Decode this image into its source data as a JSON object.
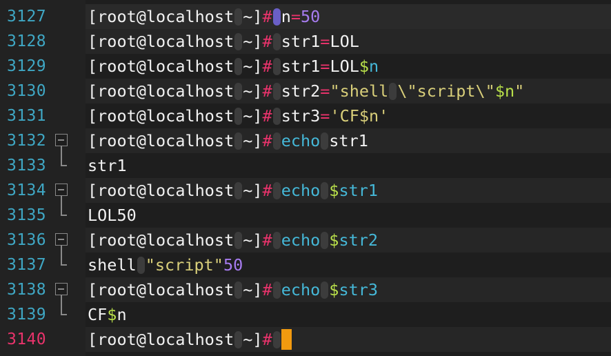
{
  "terminal": {
    "colors": {
      "background": "#1e1e1e",
      "line_number": "#3fa7c4",
      "active_line_number": "#e8336b",
      "prompt_hash": "#e8336b",
      "number": "#a77cf0",
      "string": "#d9cf7a",
      "variable": "#b9e04a",
      "command": "#45b8d8",
      "cursor": "#f29a0f"
    },
    "prompt": {
      "open": "[root@localhost",
      "dir": "~]",
      "hash": "#"
    },
    "lines": [
      {
        "number": "3127",
        "cmd": [
          {
            "t": "n",
            "c": "p"
          },
          {
            "t": "=",
            "c": "op"
          },
          {
            "t": "50",
            "c": "num"
          }
        ]
      },
      {
        "number": "3128",
        "cmd": [
          {
            "t": "str1",
            "c": "p"
          },
          {
            "t": "=",
            "c": "op"
          },
          {
            "t": "LOL",
            "c": "p"
          }
        ]
      },
      {
        "number": "3129",
        "cmd": [
          {
            "t": "str1",
            "c": "p"
          },
          {
            "t": "=",
            "c": "op"
          },
          {
            "t": "LOL",
            "c": "p"
          },
          {
            "t": "$",
            "c": "var"
          },
          {
            "t": "n",
            "c": "cmd"
          }
        ]
      },
      {
        "number": "3130",
        "cmd": [
          {
            "t": "str2",
            "c": "p"
          },
          {
            "t": "=",
            "c": "op"
          },
          {
            "t": "\"shell",
            "c": "str"
          },
          {
            "ws": true
          },
          {
            "t": "\\\"script\\\"",
            "c": "str"
          },
          {
            "t": "$n",
            "c": "var"
          },
          {
            "t": "\"",
            "c": "str"
          }
        ]
      },
      {
        "number": "3131",
        "cmd": [
          {
            "t": "str3",
            "c": "p"
          },
          {
            "t": "=",
            "c": "op"
          },
          {
            "t": "'CF$n'",
            "c": "str"
          }
        ]
      },
      {
        "number": "3132",
        "fold": "start",
        "cmd": [
          {
            "t": "echo",
            "c": "cmd"
          },
          {
            "ws": true
          },
          {
            "t": "str1",
            "c": "p"
          }
        ]
      },
      {
        "number": "3133",
        "fold": "end",
        "output": [
          {
            "t": "str1",
            "c": "p"
          }
        ]
      },
      {
        "number": "3134",
        "fold": "start",
        "cmd": [
          {
            "t": "echo",
            "c": "cmd"
          },
          {
            "ws": true
          },
          {
            "t": "$",
            "c": "var"
          },
          {
            "t": "str1",
            "c": "cmd"
          }
        ]
      },
      {
        "number": "3135",
        "fold": "end",
        "output": [
          {
            "t": "LOL50",
            "c": "p"
          }
        ]
      },
      {
        "number": "3136",
        "fold": "start",
        "cmd": [
          {
            "t": "echo",
            "c": "cmd"
          },
          {
            "ws": true
          },
          {
            "t": "$",
            "c": "var"
          },
          {
            "t": "str2",
            "c": "cmd"
          }
        ]
      },
      {
        "number": "3137",
        "fold": "end",
        "output": [
          {
            "t": "shell",
            "c": "p"
          },
          {
            "ws": true
          },
          {
            "t": "\"script\"",
            "c": "str"
          },
          {
            "t": "50",
            "c": "num"
          }
        ]
      },
      {
        "number": "3138",
        "fold": "start",
        "cmd": [
          {
            "t": "echo",
            "c": "cmd"
          },
          {
            "ws": true
          },
          {
            "t": "$",
            "c": "var"
          },
          {
            "t": "str3",
            "c": "cmd"
          }
        ]
      },
      {
        "number": "3139",
        "fold": "end",
        "output": [
          {
            "t": "CF",
            "c": "p"
          },
          {
            "t": "$",
            "c": "var"
          },
          {
            "t": "n",
            "c": "p"
          }
        ]
      },
      {
        "number": "3140",
        "active": true,
        "cursor": true,
        "cmd": []
      }
    ]
  }
}
